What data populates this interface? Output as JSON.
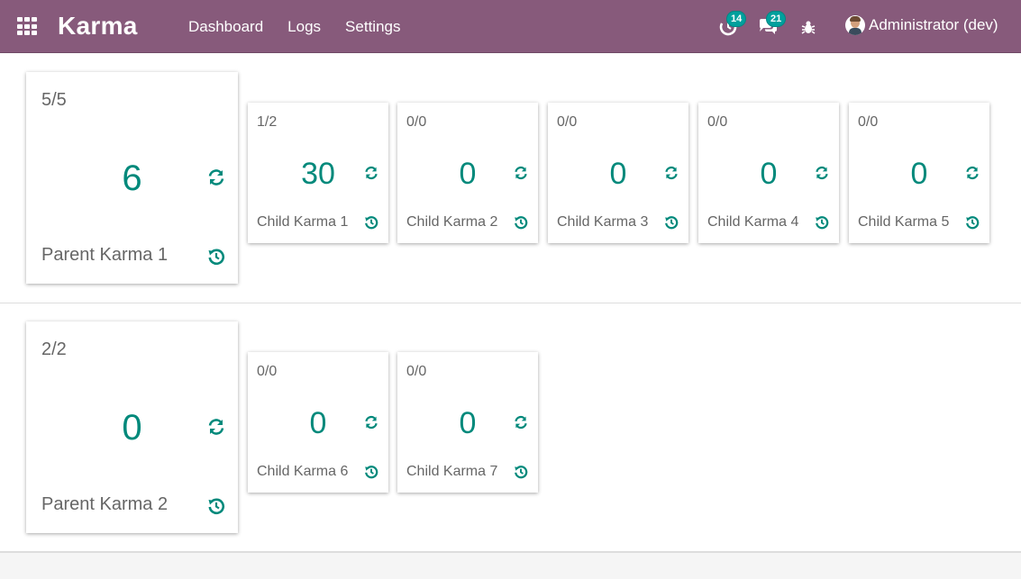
{
  "navbar": {
    "brand": "Karma",
    "menu": [
      "Dashboard",
      "Logs",
      "Settings"
    ],
    "activities_count": "14",
    "messages_count": "21",
    "user_name": "Administrator (dev)",
    "bg_color": "#875a7b",
    "badge_color": "#00a09d"
  },
  "accent_color": "#00897b",
  "groups": [
    {
      "parent": {
        "ratio": "5/5",
        "value": "6",
        "label": "Parent Karma 1"
      },
      "children": [
        {
          "ratio": "1/2",
          "value": "30",
          "label": "Child Karma 1"
        },
        {
          "ratio": "0/0",
          "value": "0",
          "label": "Child Karma 2"
        },
        {
          "ratio": "0/0",
          "value": "0",
          "label": "Child Karma 3"
        },
        {
          "ratio": "0/0",
          "value": "0",
          "label": "Child Karma 4"
        },
        {
          "ratio": "0/0",
          "value": "0",
          "label": "Child Karma 5"
        }
      ]
    },
    {
      "parent": {
        "ratio": "2/2",
        "value": "0",
        "label": "Parent Karma 2"
      },
      "children": [
        {
          "ratio": "0/0",
          "value": "0",
          "label": "Child Karma 6"
        },
        {
          "ratio": "0/0",
          "value": "0",
          "label": "Child Karma 7"
        }
      ]
    }
  ],
  "icons": {
    "apps": "apps-grid-icon",
    "activities": "clock-icon",
    "messages": "chat-bubbles-icon",
    "debug": "bug-icon",
    "refresh": "refresh-icon",
    "history": "history-icon"
  }
}
